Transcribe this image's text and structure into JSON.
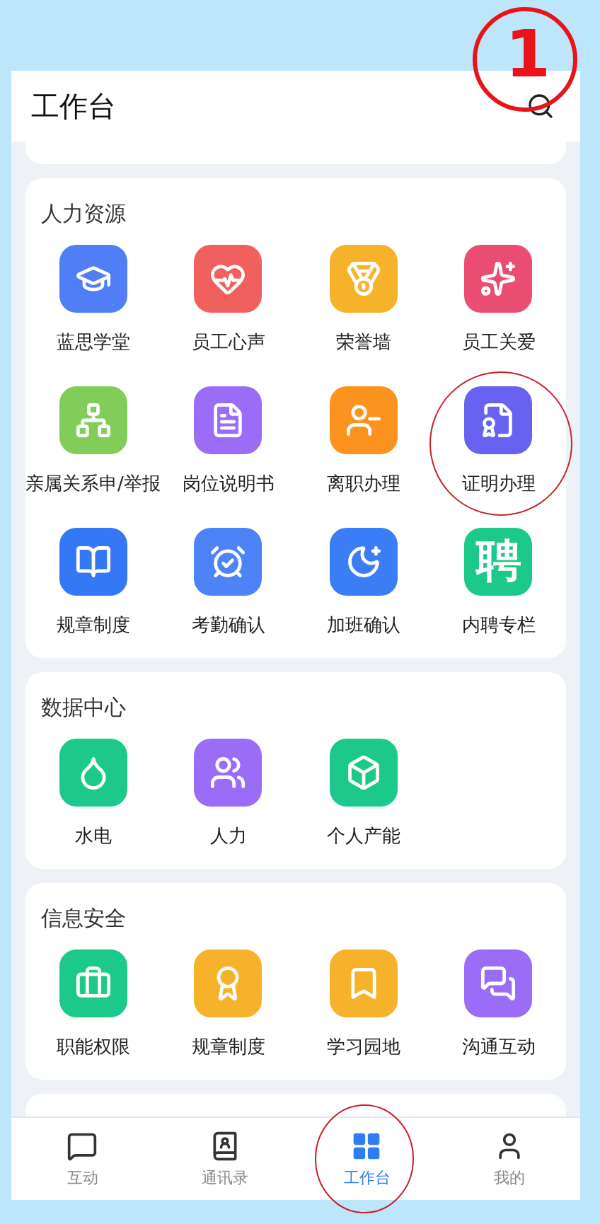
{
  "header": {
    "title": "工作台"
  },
  "sections": [
    {
      "title": "人力资源",
      "items": [
        {
          "label": "蓝思学堂",
          "color": "#4f7ef6"
        },
        {
          "label": "员工心声",
          "color": "#f0605f"
        },
        {
          "label": "荣誉墙",
          "color": "#f7b22c"
        },
        {
          "label": "员工关爱",
          "color": "#ea4d72"
        },
        {
          "label": "亲属关系申/举报",
          "color": "#82cd5a"
        },
        {
          "label": "岗位说明书",
          "color": "#9b6cf5"
        },
        {
          "label": "离职办理",
          "color": "#fb931e"
        },
        {
          "label": "证明办理",
          "color": "#6962f0"
        },
        {
          "label": "规章制度",
          "color": "#3478f6"
        },
        {
          "label": "考勤确认",
          "color": "#4e82f7"
        },
        {
          "label": "加班确认",
          "color": "#3a7df5"
        },
        {
          "label": "内聘专栏",
          "color": "#1cc98a",
          "glyph": "聘"
        }
      ]
    },
    {
      "title": "数据中心",
      "items": [
        {
          "label": "水电",
          "color": "#1cc98a"
        },
        {
          "label": "人力",
          "color": "#9b6cf5"
        },
        {
          "label": "个人产能",
          "color": "#1cc98a"
        }
      ]
    },
    {
      "title": "信息安全",
      "items": [
        {
          "label": "职能权限",
          "color": "#1cc98a"
        },
        {
          "label": "规章制度",
          "color": "#f7b22c"
        },
        {
          "label": "学习园地",
          "color": "#f7b22c"
        },
        {
          "label": "沟通互动",
          "color": "#9b6cf5"
        }
      ]
    }
  ],
  "tabs": [
    {
      "label": "互动",
      "selected": false
    },
    {
      "label": "通讯录",
      "selected": false
    },
    {
      "label": "工作台",
      "selected": true
    },
    {
      "label": "我的",
      "selected": false
    }
  ],
  "annotations": [
    {
      "kind": "numbered",
      "label": "1"
    },
    {
      "kind": "ring"
    },
    {
      "kind": "ring"
    }
  ]
}
